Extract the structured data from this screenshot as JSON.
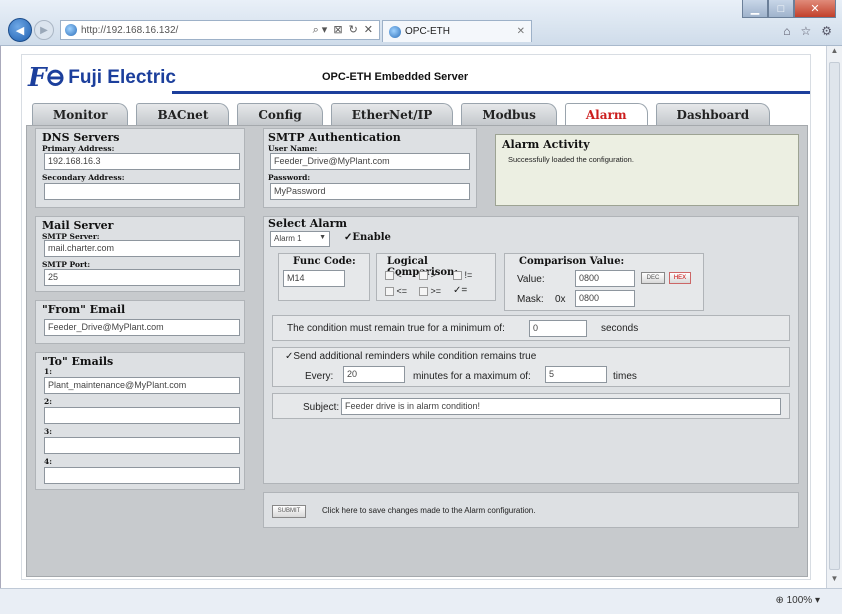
{
  "browser": {
    "url": "http://192.168.16.132/",
    "tab_title": "OPC-ETH",
    "zoom": "100%",
    "addr_icons": [
      "⌕ ▾",
      "⊠",
      "↻",
      "✕"
    ],
    "tools": [
      "⌂",
      "☆",
      "⚙"
    ]
  },
  "header": {
    "logo_mark": "F⊖",
    "logo_name": "Fuji Electric",
    "server_title": "OPC-ETH Embedded Server"
  },
  "tabs": [
    {
      "label": "Monitor"
    },
    {
      "label": "BACnet"
    },
    {
      "label": "Config"
    },
    {
      "label": "EtherNet/IP"
    },
    {
      "label": "Modbus"
    },
    {
      "label": "Alarm"
    },
    {
      "label": "Dashboard"
    }
  ],
  "dns": {
    "title": "DNS Servers",
    "primary_label": "Primary Address:",
    "primary_value": "192.168.16.3",
    "secondary_label": "Secondary Address:",
    "secondary_value": ""
  },
  "mail": {
    "title": "Mail Server",
    "smtp_label": "SMTP Server:",
    "smtp_value": "mail.charter.com",
    "port_label": "SMTP Port:",
    "port_value": "25"
  },
  "from_email": {
    "title": "\"From\" Email",
    "value": "Feeder_Drive@MyPlant.com"
  },
  "to_emails": {
    "title": "\"To\" Emails",
    "items": [
      {
        "label": "1:",
        "value": "Plant_maintenance@MyPlant.com"
      },
      {
        "label": "2:",
        "value": ""
      },
      {
        "label": "3:",
        "value": ""
      },
      {
        "label": "4:",
        "value": ""
      }
    ]
  },
  "smtp_auth": {
    "title": "SMTP Authentication",
    "user_label": "User Name:",
    "user_value": "Feeder_Drive@MyPlant.com",
    "pass_label": "Password:",
    "pass_value": "MyPassword"
  },
  "activity": {
    "title": "Alarm Activity",
    "message": "Successfully loaded the configuration."
  },
  "select_alarm": {
    "title": "Select Alarm",
    "selected": "Alarm 1",
    "enable_label": "Enable",
    "enabled": true
  },
  "func_code": {
    "title": "Func Code:",
    "value": "M14"
  },
  "logical": {
    "title": "Logical Comparison:",
    "options": [
      "<",
      ">",
      "!=",
      "<=",
      ">=",
      "="
    ],
    "checked": "="
  },
  "comparison": {
    "title": "Comparison Value:",
    "value_label": "Value:",
    "value": "0800",
    "dec_label": "DEC",
    "hex_label": "HEX",
    "mask_label": "Mask:",
    "mask_prefix": "0x",
    "mask_value": "0800"
  },
  "condition": {
    "text": "The condition must remain true for a minimum of:",
    "value": "0",
    "unit": "seconds"
  },
  "reminders": {
    "label": "Send additional reminders while condition remains true",
    "checked": true,
    "every_label": "Every:",
    "every_value": "20",
    "minutes_label": "minutes for a maximum of:",
    "max_value": "5",
    "times_label": "times"
  },
  "subject": {
    "label": "Subject:",
    "value": "Feeder drive is in alarm condition!"
  },
  "submit": {
    "button_label": "SUBMIT",
    "hint": "Click here to save changes made to the Alarm configuration."
  }
}
